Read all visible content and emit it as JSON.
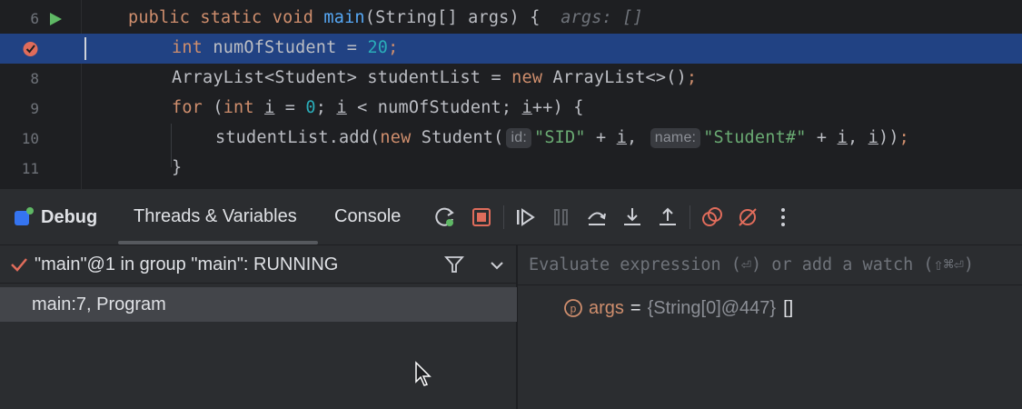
{
  "editor": {
    "lines": [
      {
        "no": "6",
        "current": false
      },
      {
        "no": "",
        "current": true
      },
      {
        "no": "8",
        "current": false
      },
      {
        "no": "9",
        "current": false
      },
      {
        "no": "10",
        "current": false
      },
      {
        "no": "11",
        "current": false
      }
    ],
    "line6": {
      "kw1": "public static void ",
      "fn": "main",
      "rest": "(String[] args) {",
      "hint": "args: []"
    },
    "line7": {
      "kw": "int ",
      "var": "numOfStudent",
      "eq": " = ",
      "num": "20",
      "end": ";"
    },
    "line8": {
      "text": "ArrayList<Student> studentList = ",
      "kw": "new",
      "rest": " ArrayList<>()",
      "end": ";"
    },
    "line9": {
      "kw": "for",
      "p1": " (",
      "kw2": "int",
      "p2": " ",
      "i1": "i",
      "p3": " = ",
      "num": "0",
      "p4": "; ",
      "i2": "i",
      "p5": " < numOfStudent; ",
      "i3": "i",
      "p6": "++) {"
    },
    "line10": {
      "p1": "studentList.add(",
      "kw": "new",
      "p2": " Student(",
      "hint1": "id:",
      "str1": "\"SID\"",
      "p3": " + ",
      "i1": "i",
      "p4": ", ",
      "hint2": "name:",
      "str2": "\"Student#\"",
      "p5": " + ",
      "i2": "i",
      "p6": ", ",
      "i3": "i",
      "p7": "))",
      "end": ";"
    },
    "line11": {
      "text": "}"
    }
  },
  "toolbar": {
    "debug_label": "Debug",
    "tabs": [
      "Threads & Variables",
      "Console"
    ]
  },
  "threads": {
    "selected_thread": "\"main\"@1 in group \"main\": RUNNING",
    "frames": [
      "main:7, Program"
    ]
  },
  "variables": {
    "eval_placeholder": "Evaluate expression (⏎) or add a watch (⇧⌘⏎)",
    "items": [
      {
        "name": "args",
        "eq": "=",
        "type": "{String[0]@447}",
        "value": "[]"
      }
    ]
  },
  "colors": {
    "accent_orange": "#cf8e6d",
    "current_line": "#214283",
    "breakpoint_red": "#e06c5b",
    "run_green": "#5fb865"
  }
}
